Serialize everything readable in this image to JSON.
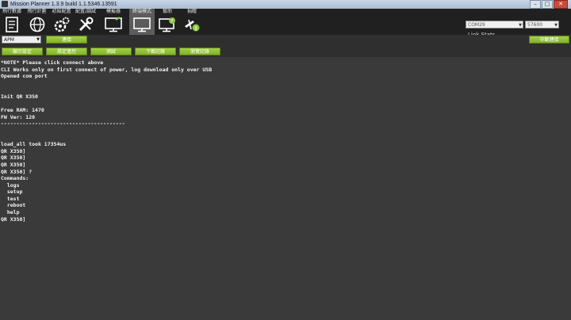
{
  "window": {
    "title": "Mission Planner 1.3.9 build 1.1.5346.13591",
    "buttons": {
      "minimize": "–",
      "maximize": "□",
      "close": "✕"
    }
  },
  "nav": [
    {
      "label": "飛行數據",
      "icon": "flight-data-icon"
    },
    {
      "label": "飛行計劃",
      "icon": "flight-plan-icon"
    },
    {
      "label": "初始配置",
      "icon": "initial-setup-icon"
    },
    {
      "label": "配置/調試",
      "icon": "config-tuning-icon"
    },
    {
      "label": "模擬器",
      "icon": "simulation-icon"
    },
    {
      "label": "終端模式",
      "icon": "terminal-icon"
    },
    {
      "label": "幫助",
      "icon": "help-icon"
    },
    {
      "label": "捐贈",
      "icon": "donate-icon"
    }
  ],
  "connection": {
    "port": "COM29",
    "baud": "57600",
    "link_stats": "Link Stats..."
  },
  "controls": {
    "apm_select": "APM",
    "connect_label": "連接",
    "disconnect_label": "中斷連接",
    "row2_buttons": [
      "顯示設定",
      "設定遙控",
      "測試",
      "下載記錄",
      "瀏覽記錄"
    ]
  },
  "terminal": {
    "lines": [
      "*NOTE* Please click connect above",
      "CLI Works only on first connect of power, log download only over USB",
      "Opened com port",
      "",
      "",
      "Init QR X350",
      "",
      "Free RAM: 1470",
      "FW Ver: 120",
      "----------------------------------------",
      "",
      "",
      "load_all took 17354us",
      "QR X350]",
      "QR X350]",
      "QR X350]",
      "QR X350] ?",
      "Commands:",
      "  logs",
      "  setup",
      "  test",
      "  reboot",
      "  help",
      "QR X350]"
    ]
  },
  "colors": {
    "accent_green": "#8cc63f",
    "toolbar_bg": "#202020",
    "terminal_bg": "#3a3a3a"
  }
}
